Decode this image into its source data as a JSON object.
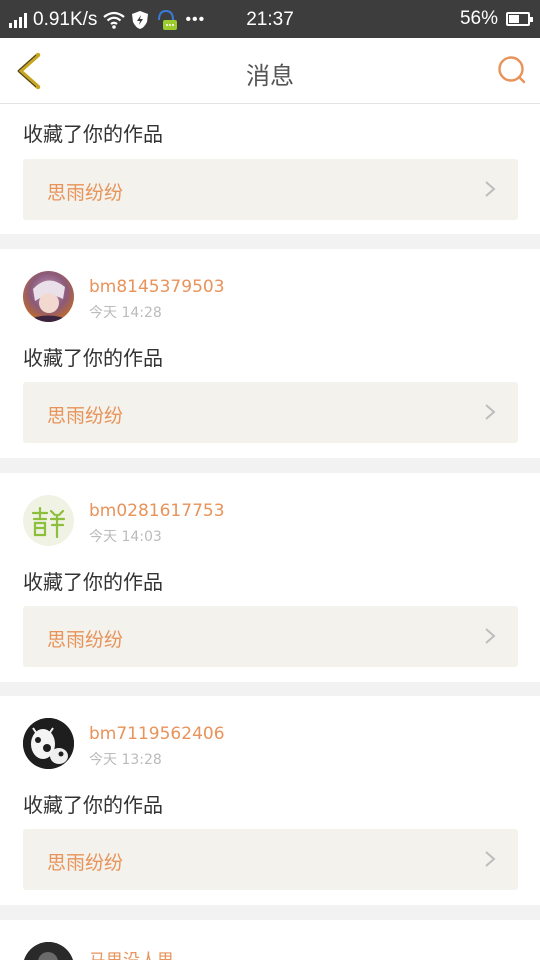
{
  "status": {
    "speed": "0.91K/s",
    "time": "21:37",
    "battery": "56%",
    "battery_level": 0.56
  },
  "header": {
    "title": "消息"
  },
  "colors": {
    "accent": "#e8935a",
    "back_icon": "#c9a51e"
  },
  "partial_item": {
    "action": "收藏了你的作品",
    "work": "思雨纷纷"
  },
  "items": [
    {
      "username": "bm8145379503",
      "time": "今天 14:28",
      "action": "收藏了你的作品",
      "work": "思雨纷纷"
    },
    {
      "username": "bm0281617753",
      "time": "今天 14:03",
      "action": "收藏了你的作品",
      "work": "思雨纷纷"
    },
    {
      "username": "bm7119562406",
      "time": "今天 13:28",
      "action": "收藏了你的作品",
      "work": "思雨纷纷"
    }
  ],
  "last_item": {
    "username": "马思没人思"
  }
}
